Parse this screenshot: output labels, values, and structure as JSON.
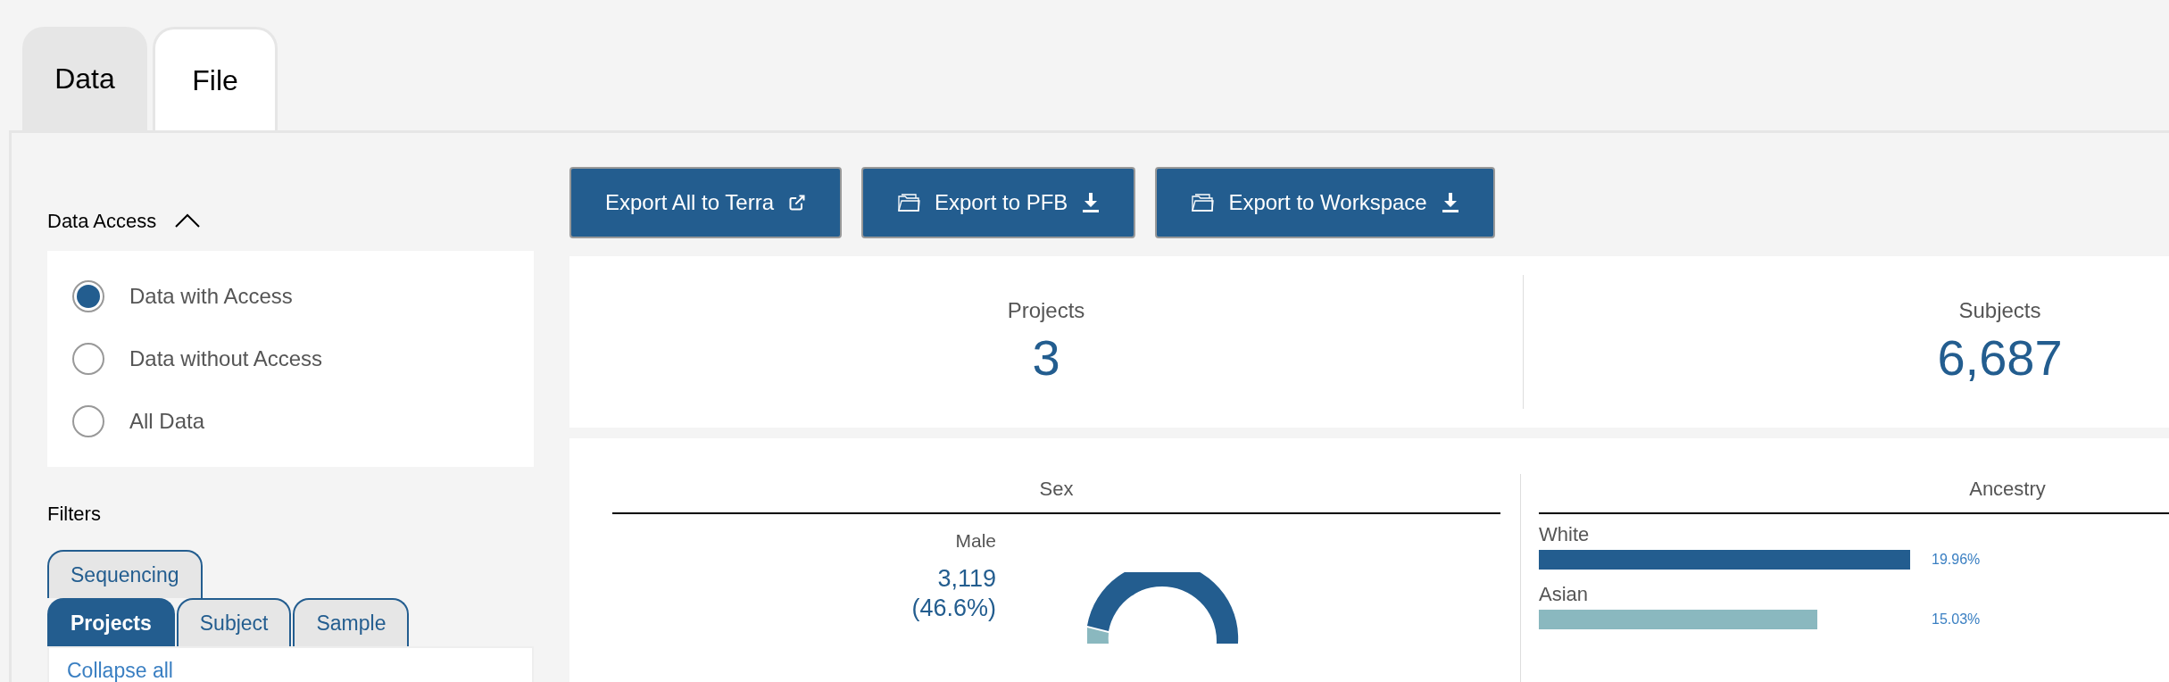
{
  "top_tabs": [
    {
      "label": "Data",
      "selected": false
    },
    {
      "label": "File",
      "selected": true
    }
  ],
  "data_access": {
    "title": "Data Access",
    "expanded": true,
    "options": [
      {
        "label": "Data with Access",
        "selected": true
      },
      {
        "label": "Data without Access",
        "selected": false
      },
      {
        "label": "All Data",
        "selected": false
      }
    ]
  },
  "filters": {
    "title": "Filters",
    "tab_rows": [
      [
        {
          "label": "Sequencing",
          "selected": false
        }
      ],
      [
        {
          "label": "Projects",
          "selected": true
        },
        {
          "label": "Subject",
          "selected": false
        },
        {
          "label": "Sample",
          "selected": false
        }
      ]
    ],
    "collapse_link": "Collapse all"
  },
  "export_buttons": [
    {
      "label": "Export All to Terra",
      "kind": "external"
    },
    {
      "label": "Export to PFB",
      "kind": "download"
    },
    {
      "label": "Export to Workspace",
      "kind": "download"
    }
  ],
  "summary": [
    {
      "label": "Projects",
      "value": "3"
    },
    {
      "label": "Subjects",
      "value": "6,687"
    }
  ],
  "sex_chart": {
    "title": "Sex",
    "legend": {
      "label": "Male",
      "count": "3,119",
      "percent": "(46.6%)"
    }
  },
  "ancestry_chart": {
    "title": "Ancestry",
    "bars": [
      {
        "label": "White",
        "level": 0.8,
        "value": "19.96%",
        "color": "#235d8f"
      },
      {
        "label": "Asian",
        "level": 0.6,
        "value": "15.03%",
        "color": "#8ab8bf"
      }
    ]
  }
}
